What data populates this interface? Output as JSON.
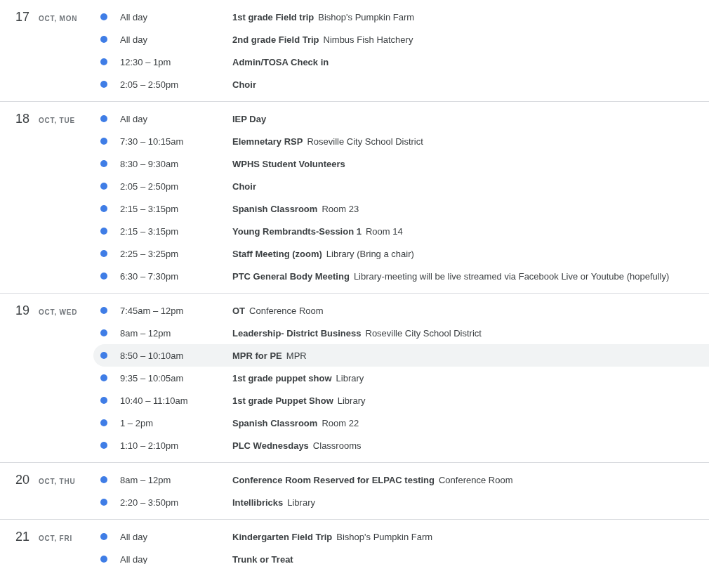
{
  "days": [
    {
      "day": "17",
      "label": "OCT, MON",
      "events": [
        {
          "time": "All day",
          "title": "1st grade Field trip",
          "location": "Bishop's Pumpkin Farm",
          "color": "#3f7de6",
          "selected": false
        },
        {
          "time": "All day",
          "title": "2nd grade Field Trip",
          "location": "Nimbus Fish Hatchery",
          "color": "#3f7de6",
          "selected": false
        },
        {
          "time": "12:30 – 1pm",
          "title": "Admin/TOSA Check in",
          "color": "#3f7de6",
          "selected": false
        },
        {
          "time": "2:05 – 2:50pm",
          "title": "Choir",
          "color": "#3f7de6",
          "selected": false
        }
      ]
    },
    {
      "day": "18",
      "label": "OCT, TUE",
      "events": [
        {
          "time": "All day",
          "title": "IEP Day",
          "color": "#3f7de6",
          "selected": false
        },
        {
          "time": "7:30 – 10:15am",
          "title": "Elemnetary RSP",
          "location": "Roseville City School District",
          "color": "#3f7de6",
          "selected": false
        },
        {
          "time": "8:30 – 9:30am",
          "title": "WPHS Student Volunteers",
          "color": "#3f7de6",
          "selected": false
        },
        {
          "time": "2:05 – 2:50pm",
          "title": "Choir",
          "color": "#3f7de6",
          "selected": false
        },
        {
          "time": "2:15 – 3:15pm",
          "title": "Spanish Classroom",
          "location": "Room 23",
          "color": "#3f7de6",
          "selected": false
        },
        {
          "time": "2:15 – 3:15pm",
          "title": "Young Rembrandts-Session 1",
          "location": "Room 14",
          "color": "#3f7de6",
          "selected": false
        },
        {
          "time": "2:25 – 3:25pm",
          "title": "Staff Meeting (zoom)",
          "location": "Library (Bring a chair)",
          "color": "#3f7de6",
          "selected": false
        },
        {
          "time": "6:30 – 7:30pm",
          "title": "PTC General Body Meeting",
          "location": "Library-meeting will be live streamed via Facebook Live or Youtube (hopefully)",
          "color": "#3f7de6",
          "selected": false
        }
      ]
    },
    {
      "day": "19",
      "label": "OCT, WED",
      "events": [
        {
          "time": "7:45am – 12pm",
          "title": "OT",
          "location": "Conference Room",
          "color": "#3f7de6",
          "selected": false
        },
        {
          "time": "8am – 12pm",
          "title": "Leadership- District Business",
          "location": "Roseville City School District",
          "color": "#3f7de6",
          "selected": false
        },
        {
          "time": "8:50 – 10:10am",
          "title": "MPR for PE",
          "location": "MPR",
          "color": "#3f7de6",
          "selected": true
        },
        {
          "time": "9:35 – 10:05am",
          "title": "1st grade puppet show",
          "location": "Library",
          "color": "#3f7de6",
          "selected": false
        },
        {
          "time": "10:40 – 11:10am",
          "title": "1st grade Puppet Show",
          "location": "Library",
          "color": "#3f7de6",
          "selected": false
        },
        {
          "time": "1 – 2pm",
          "title": "Spanish Classroom",
          "location": "Room 22",
          "color": "#3f7de6",
          "selected": false
        },
        {
          "time": "1:10 – 2:10pm",
          "title": "PLC Wednesdays",
          "location": "Classrooms",
          "color": "#3f7de6",
          "selected": false
        }
      ]
    },
    {
      "day": "20",
      "label": "OCT, THU",
      "events": [
        {
          "time": "8am – 12pm",
          "title": "Conference Room Reserved for ELPAC testing",
          "location": "Conference Room",
          "color": "#3f7de6",
          "selected": false
        },
        {
          "time": "2:20 – 3:50pm",
          "title": "Intellibricks",
          "location": "Library",
          "color": "#3f7de6",
          "selected": false
        }
      ]
    },
    {
      "day": "21",
      "label": "OCT, FRI",
      "events": [
        {
          "time": "All day",
          "title": "Kindergarten Field Trip",
          "location": "Bishop's Pumpkin Farm",
          "color": "#3f7de6",
          "selected": false
        },
        {
          "time": "All day",
          "title": "Trunk or Treat",
          "color": "#3f7de6",
          "selected": false
        }
      ]
    }
  ]
}
